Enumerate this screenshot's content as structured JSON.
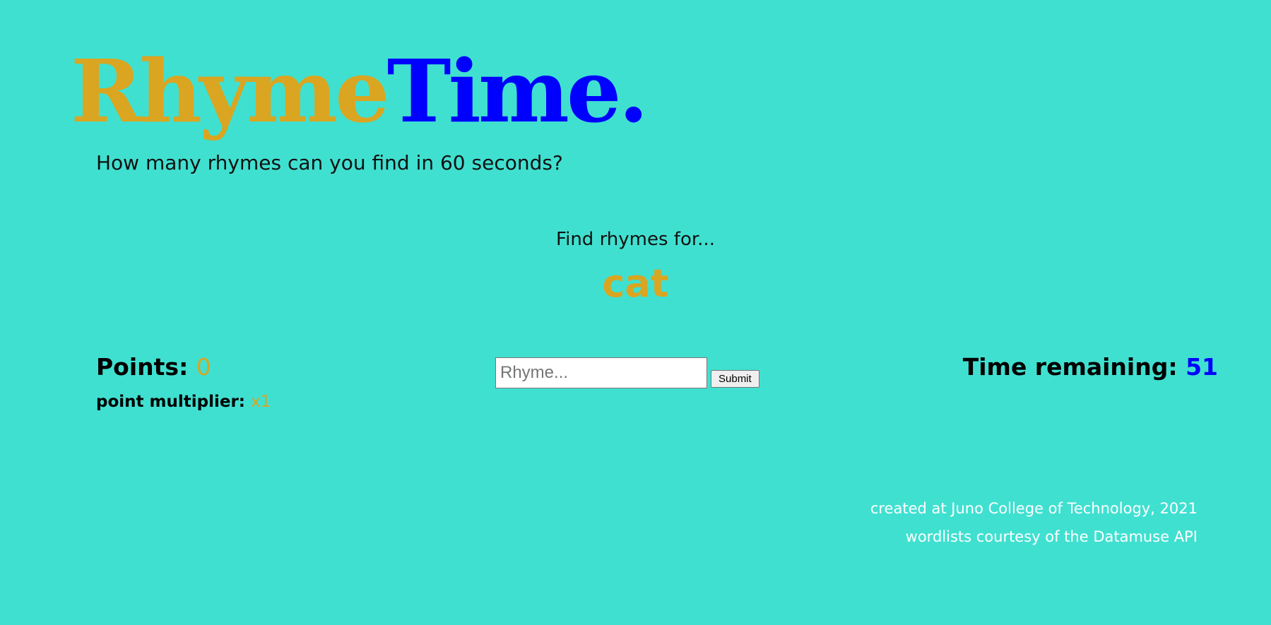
{
  "colors": {
    "background": "#40e0d0",
    "gold": "#daa520",
    "blue": "#0000ff",
    "text": "#000000",
    "footer_text": "#ffffff"
  },
  "header": {
    "logo_part1": "Rhyme",
    "logo_part2": "Time.",
    "tagline": "How many rhymes can you find in 60 seconds?"
  },
  "game": {
    "prompt_label": "Find rhymes for...",
    "target_word": "cat",
    "points_label": "Points:",
    "points_value": "0",
    "multiplier_label": "point multiplier:",
    "multiplier_value": "x1",
    "time_label": "Time remaining:",
    "time_value": "51"
  },
  "form": {
    "input_value": "",
    "input_placeholder": "Rhyme...",
    "submit_label": "Submit"
  },
  "footer": {
    "credit": "created at Juno College of Technology, 2021",
    "api_credit": "wordlists courtesy of the Datamuse API"
  }
}
